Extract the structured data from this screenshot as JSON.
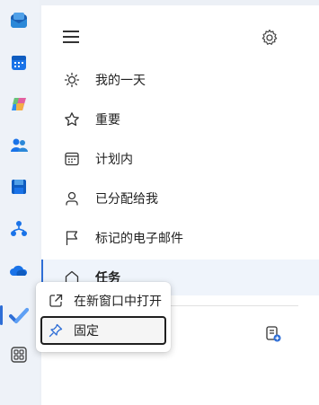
{
  "rail": {
    "apps": [
      {
        "name": "mail-app",
        "icon": "mail-icon"
      },
      {
        "name": "calendar-app",
        "icon": "calendar-icon"
      },
      {
        "name": "copilot-app",
        "icon": "copilot-icon"
      },
      {
        "name": "people-app",
        "icon": "people-icon"
      },
      {
        "name": "save-app",
        "icon": "floppy-icon"
      },
      {
        "name": "org-app",
        "icon": "org-chart-icon"
      },
      {
        "name": "onedrive-app",
        "icon": "cloud-icon"
      },
      {
        "name": "todo-app",
        "icon": "checkmark-icon"
      },
      {
        "name": "more-apps",
        "icon": "apps-grid-icon"
      }
    ],
    "active": "todo-app"
  },
  "panel": {
    "nav": [
      {
        "id": "my-day",
        "label": "我的一天",
        "icon": "sun-icon"
      },
      {
        "id": "important",
        "label": "重要",
        "icon": "star-icon"
      },
      {
        "id": "planned",
        "label": "计划内",
        "icon": "calendar-grid-icon"
      },
      {
        "id": "assigned",
        "label": "已分配给我",
        "icon": "person-icon"
      },
      {
        "id": "flagged",
        "label": "标记的电子邮件",
        "icon": "flag-icon"
      },
      {
        "id": "tasks",
        "label": "任务",
        "icon": "home-icon",
        "selected": true
      }
    ]
  },
  "context_menu": {
    "items": [
      {
        "id": "open-new-window",
        "label": "在新窗口中打开",
        "icon": "open-external-icon"
      },
      {
        "id": "pin",
        "label": "固定",
        "icon": "pin-icon",
        "focused": true
      }
    ]
  },
  "colors": {
    "accent": "#2e6ed6",
    "rail_bg": "#eef2f8",
    "panel_bg": "#ffffff",
    "selected_bg": "#eff4fb"
  }
}
